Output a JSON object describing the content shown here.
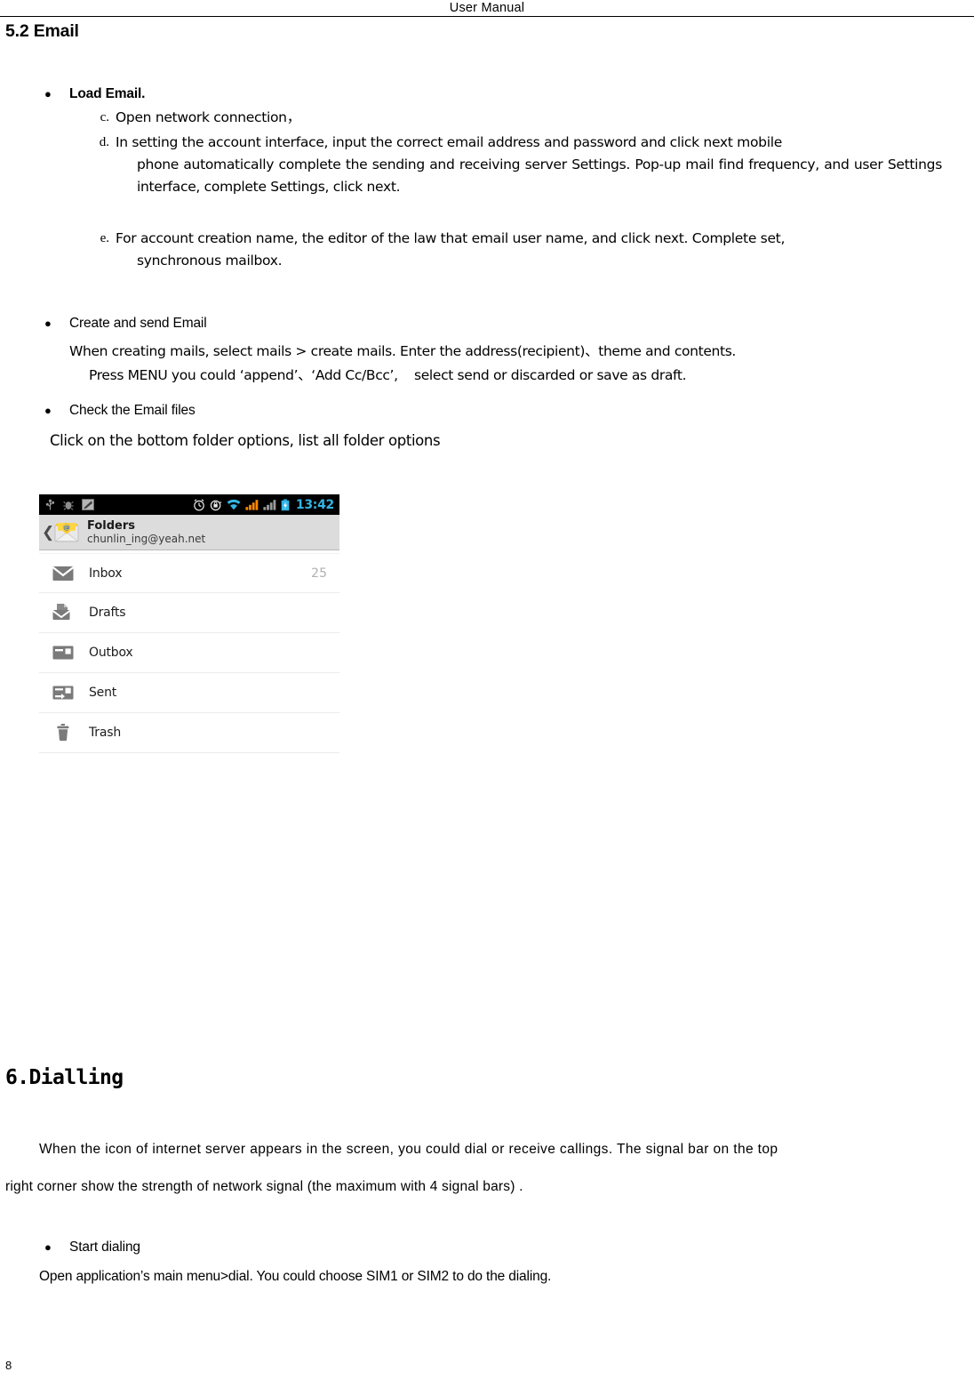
{
  "header": {
    "title": "User    Manual"
  },
  "page_number": "8",
  "section": {
    "heading": "5.2 Email"
  },
  "load_email": {
    "bullet": "Load Email.",
    "items": [
      {
        "marker": "c.",
        "text": "Open network connection，"
      },
      {
        "marker": "d.",
        "line1": "In setting the account interface, input the correct email address and password and click next mobile",
        "line2": "phone automatically complete the sending and receiving server Settings. Pop-up mail find frequency, and user Settings interface, complete Settings, click next."
      },
      {
        "marker": "e.",
        "line1": "For account creation name, the editor of the law that email user name, and click next. Complete set,",
        "line2": "synchronous mailbox."
      }
    ]
  },
  "create_send": {
    "bullet": "Create and send Email",
    "line1": "When creating mails, select mails > create mails. Enter the address(recipient)、theme and contents.",
    "line2": "Press MENU you could ‘append’、‘Add Cc/Bcc’,    select send or discarded or save as draft."
  },
  "check_files": {
    "bullet": "Check the Email files",
    "line1": "Click on the bottom folder options, list all folder options"
  },
  "screenshot": {
    "status_bar": {
      "time": "13:42",
      "left_icons": [
        "usb-icon",
        "debug-icon",
        "screenshot-icon"
      ],
      "right_icons": [
        "alarm-clock-icon",
        "rotation-lock-icon",
        "wifi-icon",
        "signal-sim1-icon",
        "signal-sim2-icon",
        "battery-icon"
      ],
      "colors": {
        "accent": "#33b5e5",
        "signal_active": "#ff8800",
        "background": "#000000"
      }
    },
    "account_bar": {
      "title": "Folders",
      "account": "chunlin_ing@yeah.net",
      "back_icon": "back-chevron-icon",
      "app_icon": "email-envelope-icon",
      "background": "#dcdcdc"
    },
    "folders": [
      {
        "name": "Inbox",
        "count": "25",
        "icon": "inbox-envelope-icon"
      },
      {
        "name": "Drafts",
        "count": "",
        "icon": "drafts-icon"
      },
      {
        "name": "Outbox",
        "count": "",
        "icon": "outbox-icon"
      },
      {
        "name": "Sent",
        "count": "",
        "icon": "sent-icon"
      },
      {
        "name": "Trash",
        "count": "",
        "icon": "trash-icon"
      }
    ]
  },
  "dialling": {
    "heading": "6.Dialling",
    "para_line1": "When the icon of internet server appears in the screen, you could dial or receive callings. The signal bar on the top",
    "para_line2": "right corner show the strength of network signal (the maximum with 4 signal bars) .",
    "bullet": "Start dialing",
    "line1": "Open application’s main menu>dial. You could choose SIM1 or SIM2 to do the dialing."
  }
}
